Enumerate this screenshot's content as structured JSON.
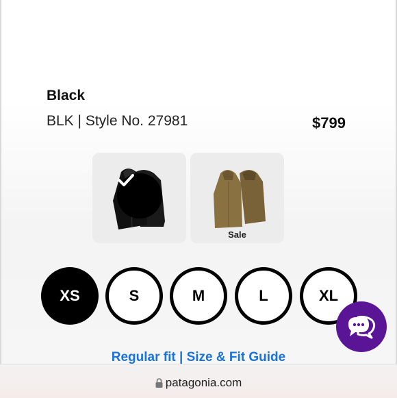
{
  "product": {
    "color_name": "Black",
    "style_line": "BLK | Style No. 27981",
    "price": "$799"
  },
  "swatches": [
    {
      "name": "black",
      "selected": true,
      "label": ""
    },
    {
      "name": "brown",
      "selected": false,
      "label": "Sale"
    }
  ],
  "sizes": [
    {
      "label": "XS",
      "selected": true
    },
    {
      "label": "S",
      "selected": false
    },
    {
      "label": "M",
      "selected": false
    },
    {
      "label": "L",
      "selected": false
    },
    {
      "label": "XL",
      "selected": false
    }
  ],
  "fit_link": "Regular fit | Size & Fit Guide",
  "browser": {
    "url": "patagonia.com",
    "icon": "lock-icon"
  },
  "chat": {
    "icon": "chat-bubbles-icon",
    "color": "#5a1596"
  }
}
